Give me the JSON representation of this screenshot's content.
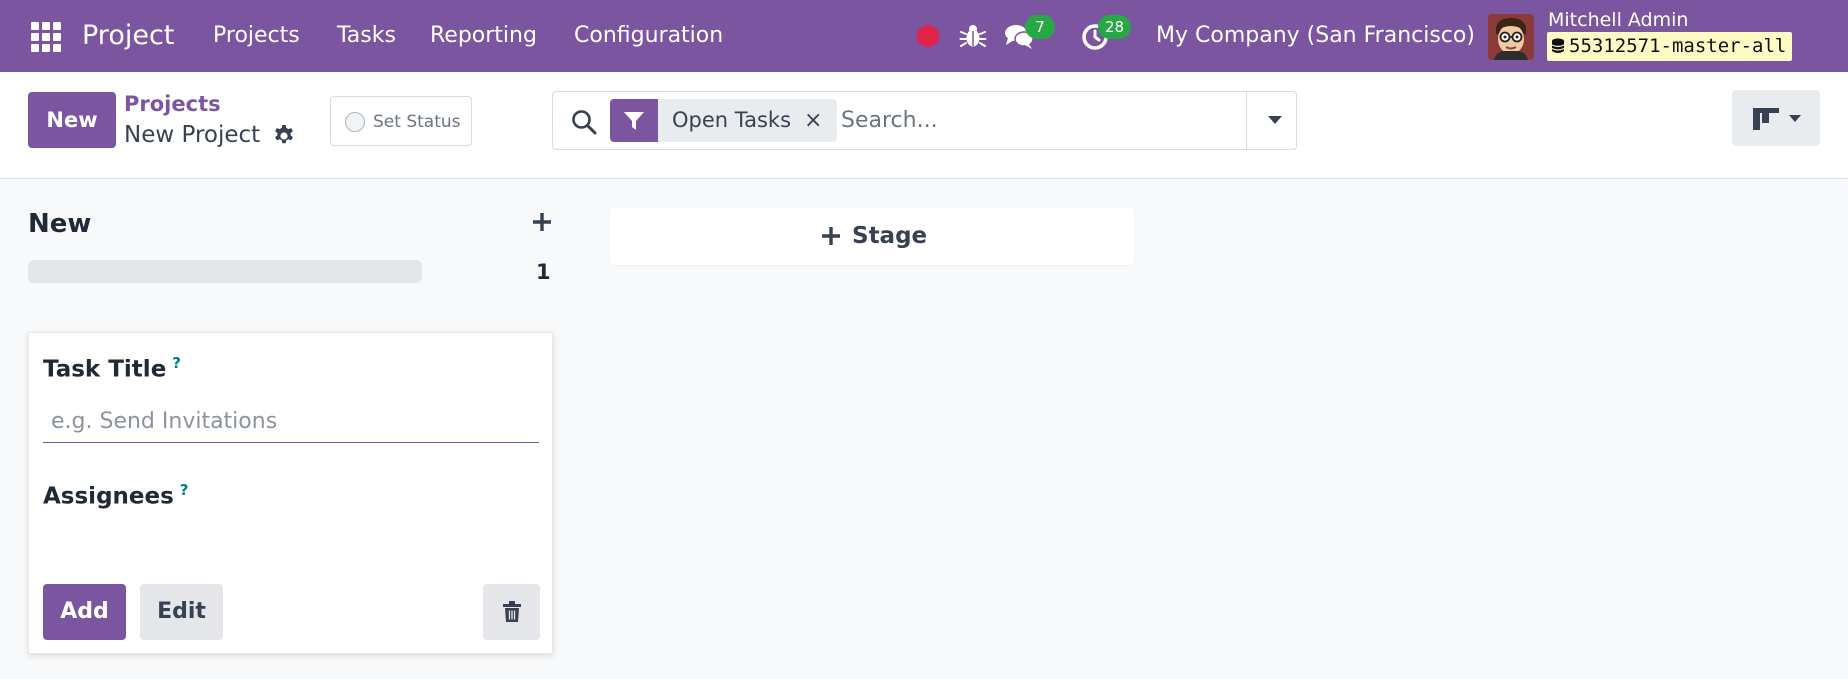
{
  "navbar": {
    "app_title": "Project",
    "menu": [
      "Projects",
      "Tasks",
      "Reporting",
      "Configuration"
    ],
    "messages_count": "7",
    "activities_count": "28",
    "company": "My Company (San Francisco)",
    "user_name": "Mitchell Admin",
    "database": "55312571-master-all",
    "icons": [
      "apps-grid-icon",
      "record-dot-icon",
      "bug-icon",
      "chat-bubbles-icon",
      "clock-activity-icon"
    ]
  },
  "control": {
    "new_label": "New",
    "breadcrumb_parent": "Projects",
    "breadcrumb_current": "New Project",
    "set_status_label": "Set Status",
    "search": {
      "facet": "Open Tasks",
      "placeholder": "Search...",
      "value": ""
    }
  },
  "kanban": {
    "column": {
      "title": "New",
      "count": "1"
    },
    "quick_create": {
      "task_title_label": "Task Title",
      "task_title_placeholder": "e.g. Send Invitations",
      "task_title_value": "",
      "help_mark": "?",
      "assignees_label": "Assignees",
      "add_label": "Add",
      "edit_label": "Edit"
    },
    "add_stage_label": "Stage"
  },
  "colors": {
    "brand": "#7c55a0",
    "badge": "#28a745",
    "recording": "#e02346",
    "help": "#017e84"
  }
}
